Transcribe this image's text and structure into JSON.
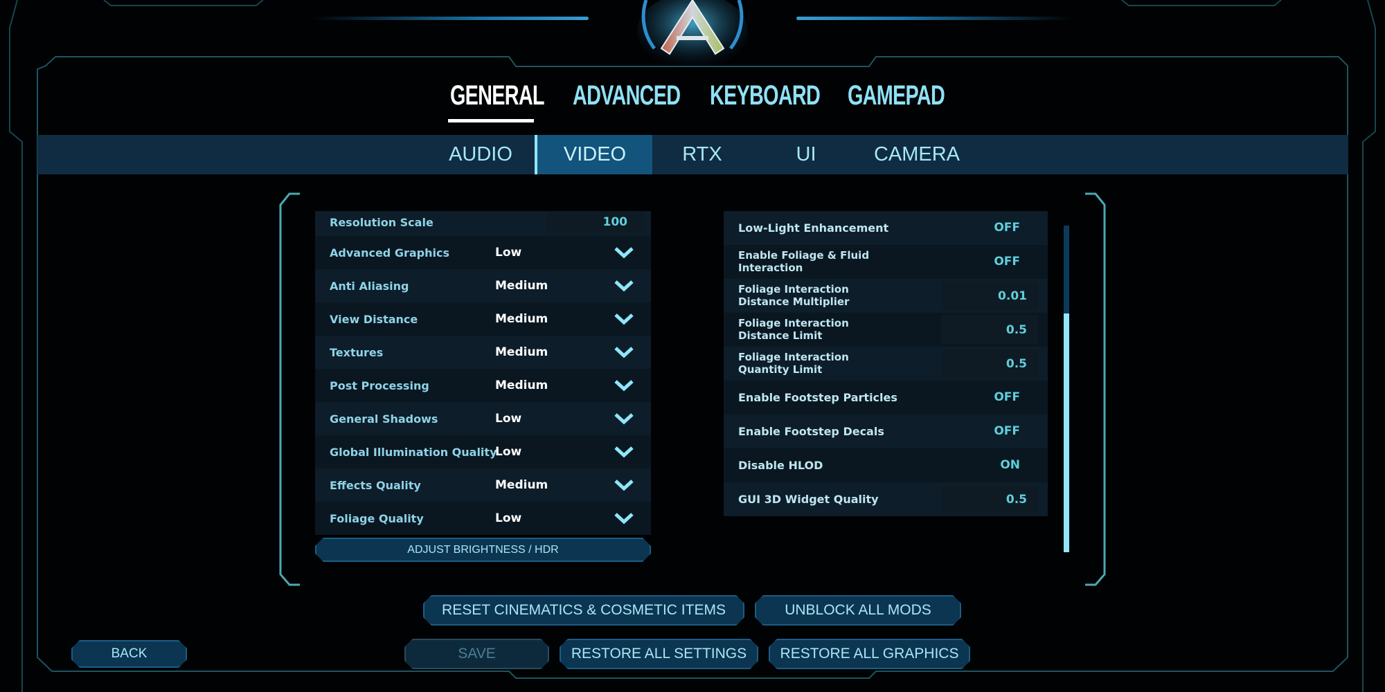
{
  "logo": {
    "icon": "ark-logo-icon"
  },
  "top_tabs": [
    {
      "label": "GENERAL",
      "active": true
    },
    {
      "label": "ADVANCED",
      "active": false
    },
    {
      "label": "KEYBOARD",
      "active": false
    },
    {
      "label": "GAMEPAD",
      "active": false
    }
  ],
  "sub_tabs": [
    {
      "label": "AUDIO",
      "active": false
    },
    {
      "label": "VIDEO",
      "active": true
    },
    {
      "label": "RTX",
      "active": false
    },
    {
      "label": "UI",
      "active": false
    },
    {
      "label": "CAMERA",
      "active": false
    }
  ],
  "left_panel": {
    "resolution_scale": {
      "label": "Resolution Scale",
      "value": "100"
    },
    "dropdowns": [
      {
        "label": "Advanced Graphics",
        "value": "Low"
      },
      {
        "label": "Anti Aliasing",
        "value": "Medium"
      },
      {
        "label": "View Distance",
        "value": "Medium"
      },
      {
        "label": "Textures",
        "value": "Medium"
      },
      {
        "label": "Post Processing",
        "value": "Medium"
      },
      {
        "label": "General Shadows",
        "value": "Low"
      },
      {
        "label": "Global Illumination Quality",
        "value": "Low"
      },
      {
        "label": "Effects Quality",
        "value": "Medium"
      },
      {
        "label": "Foliage Quality",
        "value": "Low"
      }
    ],
    "brightness_button": "ADJUST BRIGHTNESS / HDR"
  },
  "right_panel": {
    "rows": [
      {
        "label_line1": "Low-Light Enhancement",
        "label_line2": "",
        "value": "OFF",
        "kind": "toggle"
      },
      {
        "label_line1": "Enable Foliage & Fluid",
        "label_line2": "Interaction",
        "value": "OFF",
        "kind": "toggle"
      },
      {
        "label_line1": "Foliage Interaction",
        "label_line2": "Distance Multiplier",
        "value": "0.01",
        "kind": "number"
      },
      {
        "label_line1": "Foliage Interaction",
        "label_line2": "Distance Limit",
        "value": "0.5",
        "kind": "number"
      },
      {
        "label_line1": "Foliage Interaction",
        "label_line2": "Quantity Limit",
        "value": "0.5",
        "kind": "number"
      },
      {
        "label_line1": "Enable Footstep Particles",
        "label_line2": "",
        "value": "OFF",
        "kind": "toggle"
      },
      {
        "label_line1": "Enable Footstep Decals",
        "label_line2": "",
        "value": "OFF",
        "kind": "toggle"
      },
      {
        "label_line1": "Disable HLOD",
        "label_line2": "",
        "value": "ON",
        "kind": "toggle"
      },
      {
        "label_line1": "GUI 3D Widget Quality",
        "label_line2": "",
        "value": "0.5",
        "kind": "number"
      }
    ],
    "scrollbar": {
      "thumb_start_fraction": 0.27,
      "thumb_end_fraction": 1.0
    }
  },
  "buttons": {
    "reset_cinematics": "RESET CINEMATICS & COSMETIC ITEMS",
    "unblock_mods": "UNBLOCK ALL MODS",
    "back": "BACK",
    "save": "SAVE",
    "restore_settings": "RESTORE ALL SETTINGS",
    "restore_graphics": "RESTORE ALL GRAPHICS"
  },
  "colors": {
    "accent": "#8fe1f5",
    "active_subtab": "#13547c",
    "subtab_bar": "#0f2c42",
    "value_cyan": "#5fcfdc",
    "frame_line": "#1f5660"
  }
}
